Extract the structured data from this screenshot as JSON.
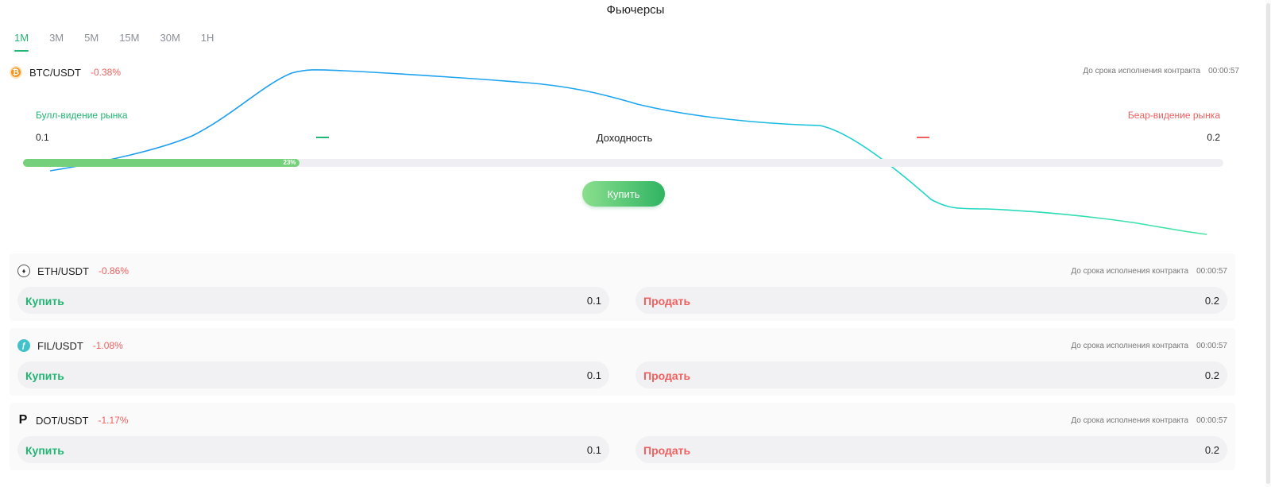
{
  "page_title": "Фьючерсы",
  "tabs": [
    {
      "label": "1M",
      "active": true
    },
    {
      "label": "3M",
      "active": false
    },
    {
      "label": "5M",
      "active": false
    },
    {
      "label": "15M",
      "active": false
    },
    {
      "label": "30M",
      "active": false
    },
    {
      "label": "1H",
      "active": false
    }
  ],
  "colors": {
    "accent_green": "#22b573",
    "accent_red": "#f0605e"
  },
  "main": {
    "pair": "BTC/USDT",
    "change": "-0.38%",
    "icon": "bitcoin-icon",
    "expiry_label": "До срока исполнения контракта",
    "expiry_time": "00:00:57",
    "bull_label": "Булл-видение рынка",
    "bear_label": "Беар-видение рынка",
    "bull_value": "0.1",
    "bear_value": "0.2",
    "yield_label": "Доходность",
    "progress_percent": 23,
    "progress_text": "23%",
    "buy_label": "Купить"
  },
  "pairs": [
    {
      "pair": "ETH/USDT",
      "change": "-0.86%",
      "icon": "ethereum-icon",
      "expiry_label": "До срока исполнения контракта",
      "expiry_time": "00:00:57",
      "buy_label": "Купить",
      "buy_value": "0.1",
      "sell_label": "Продать",
      "sell_value": "0.2"
    },
    {
      "pair": "FIL/USDT",
      "change": "-1.08%",
      "icon": "filecoin-icon",
      "expiry_label": "До срока исполнения контракта",
      "expiry_time": "00:00:57",
      "buy_label": "Купить",
      "buy_value": "0.1",
      "sell_label": "Продать",
      "sell_value": "0.2"
    },
    {
      "pair": "DOT/USDT",
      "change": "-1.17%",
      "icon": "polkadot-icon",
      "expiry_label": "До срока исполнения контракта",
      "expiry_time": "00:00:57",
      "buy_label": "Купить",
      "buy_value": "0.1",
      "sell_label": "Продать",
      "sell_value": "0.2"
    }
  ]
}
